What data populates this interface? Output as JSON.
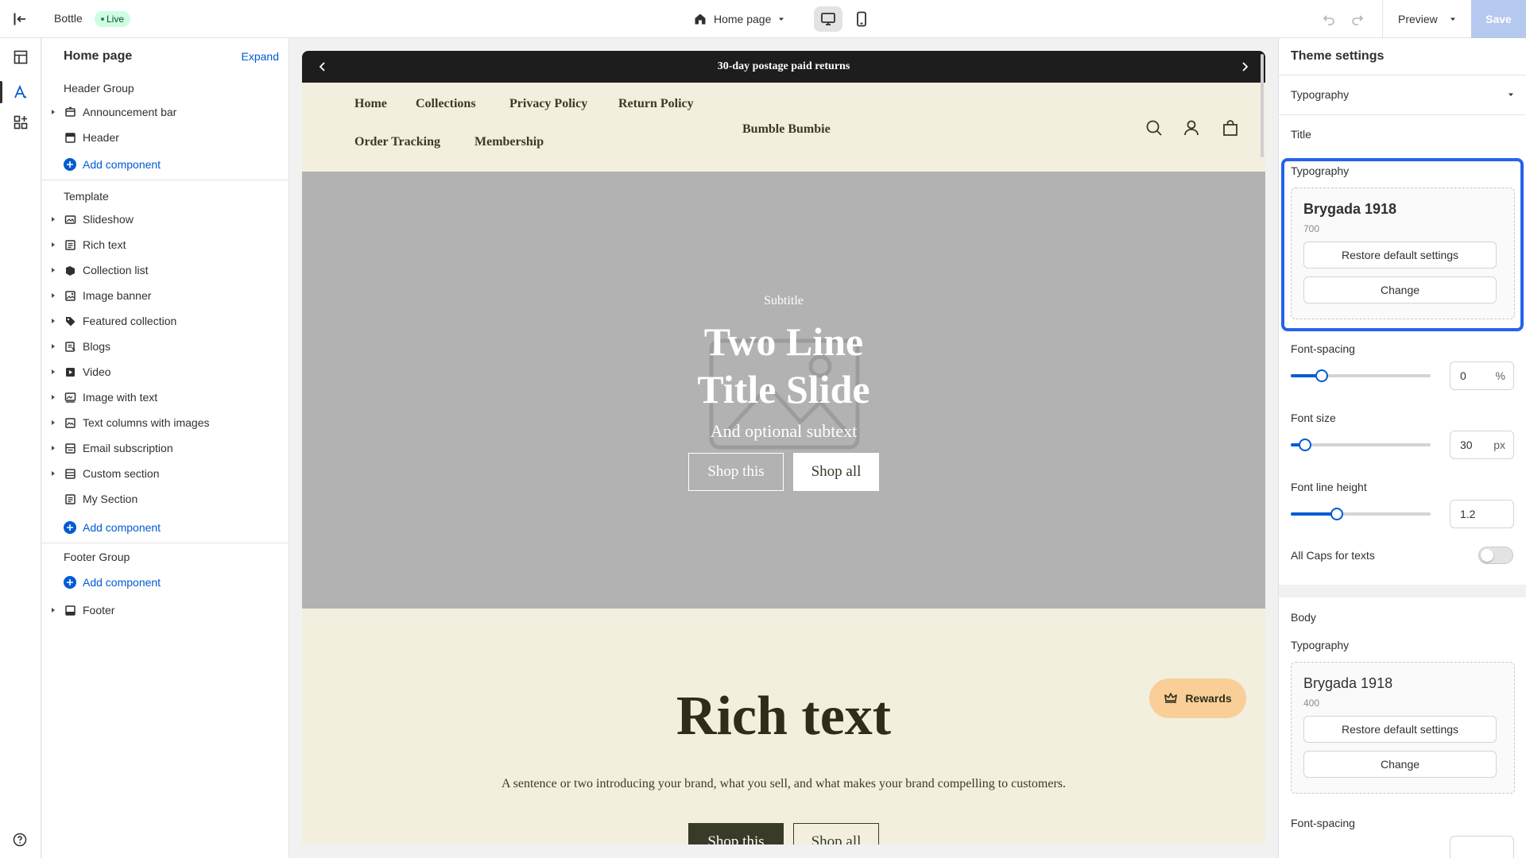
{
  "topbar": {
    "store_name": "Bottle",
    "status": "Live",
    "page_selector": "Home page",
    "preview_label": "Preview",
    "save_label": "Save"
  },
  "sidebar": {
    "title": "Home page",
    "expand_label": "Expand",
    "header_group": {
      "label": "Header Group",
      "items": [
        {
          "label": "Announcement bar",
          "icon": "announcement-icon",
          "expandable": true
        },
        {
          "label": "Header",
          "icon": "layout-header-icon",
          "expandable": false
        }
      ],
      "add_label": "Add component"
    },
    "template": {
      "label": "Template",
      "items": [
        {
          "label": "Slideshow",
          "icon": "slideshow-icon",
          "expandable": true
        },
        {
          "label": "Rich text",
          "icon": "text-block-icon",
          "expandable": true
        },
        {
          "label": "Collection list",
          "icon": "collection-icon",
          "expandable": true
        },
        {
          "label": "Image banner",
          "icon": "image-icon",
          "expandable": true
        },
        {
          "label": "Featured collection",
          "icon": "tag-icon",
          "expandable": true
        },
        {
          "label": "Blogs",
          "icon": "blog-icon",
          "expandable": true
        },
        {
          "label": "Video",
          "icon": "video-icon",
          "expandable": true
        },
        {
          "label": "Image with text",
          "icon": "image-text-icon",
          "expandable": true
        },
        {
          "label": "Text columns with images",
          "icon": "columns-image-icon",
          "expandable": true
        },
        {
          "label": "Email subscription",
          "icon": "email-section-icon",
          "expandable": true
        },
        {
          "label": "Custom section",
          "icon": "section-icon",
          "expandable": true
        },
        {
          "label": "My Section",
          "icon": "text-block-icon",
          "expandable": false
        }
      ],
      "add_label": "Add component"
    },
    "footer_group": {
      "label": "Footer Group",
      "add_label": "Add component",
      "items": [
        {
          "label": "Footer",
          "icon": "layout-footer-icon",
          "expandable": true
        }
      ]
    }
  },
  "store": {
    "announcement": "30-day postage paid returns",
    "nav_links": [
      "Home",
      "Collections",
      "Privacy Policy",
      "Return Policy",
      "Order Tracking",
      "Membership"
    ],
    "brand": "Bumble Bumbie",
    "hero": {
      "subtitle": "Subtitle",
      "title_line1": "Two Line",
      "title_line2": "Title Slide",
      "subtext": "And optional subtext",
      "button1": "Shop this",
      "button2": "Shop all"
    },
    "rich_text": {
      "heading": "Rich text",
      "body": "A sentence or two introducing your brand, what you sell, and what makes your brand compelling to customers.",
      "button1": "Shop this",
      "button2": "Shop all"
    },
    "rewards_label": "Rewards"
  },
  "panel": {
    "title": "Theme settings",
    "category": "Typography",
    "title_section": {
      "heading": "Title",
      "typography_label": "Typography",
      "font_name": "Brygada 1918",
      "font_weight": "700",
      "restore_label": "Restore default settings",
      "change_label": "Change",
      "font_spacing_label": "Font-spacing",
      "font_spacing_value": "0",
      "font_spacing_unit": "%",
      "font_spacing_level": 0.22,
      "font_size_label": "Font size",
      "font_size_value": "30",
      "font_size_unit": "px",
      "font_size_level": 0.1,
      "line_height_label": "Font line height",
      "line_height_value": "1.2",
      "line_height_level": 0.33,
      "all_caps_label": "All Caps for texts",
      "all_caps_on": false
    },
    "body_section": {
      "heading": "Body",
      "typography_label": "Typography",
      "font_name": "Brygada 1918",
      "font_weight": "400",
      "restore_label": "Restore default settings",
      "change_label": "Change",
      "font_spacing_label": "Font-spacing"
    }
  },
  "colors": {
    "accent": "#005bd3",
    "focus_outline": "#2463eb",
    "store_bg": "#f2efdf",
    "hero_bg": "#b2b2b2",
    "rewards_bg": "#f9cf97",
    "dark_text": "#3a3a28"
  }
}
